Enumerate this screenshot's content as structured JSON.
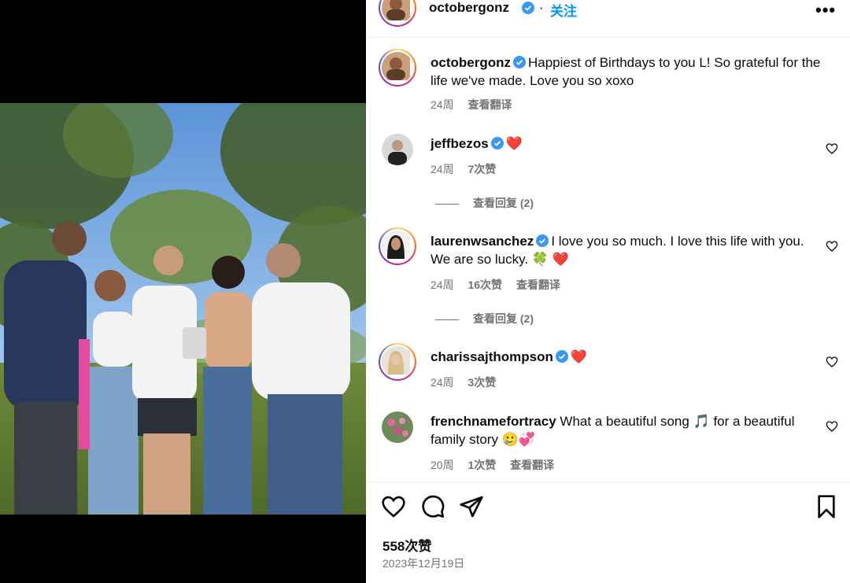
{
  "post": {
    "author": "octobergonz",
    "follow_label": "关注",
    "dot": "·",
    "more_label": "•••",
    "caption_author": "octobergonz",
    "caption_text": "Happiest of Birthdays to you L! So grateful for the life we've made. Love you so xoxo",
    "caption_time": "24周",
    "caption_translate": "查看翻译"
  },
  "comments": [
    {
      "user": "jeffbezos",
      "text": "❤️",
      "time": "24周",
      "likes": "7次赞",
      "translate": "",
      "replies": "查看回复 (2)"
    },
    {
      "user": "laurenwsanchez",
      "text": "I love you so much. I love this life with you. We are so lucky. 🍀 ❤️",
      "time": "24周",
      "likes": "16次赞",
      "translate": "查看翻译",
      "replies": "查看回复 (2)"
    },
    {
      "user": "charissajthompson",
      "text": "❤️",
      "time": "24周",
      "likes": "3次赞",
      "translate": "",
      "replies": ""
    },
    {
      "user": "frenchnamefortracy",
      "text": "What a beautiful song 🎵 for a beautiful family story 🥲💞",
      "time": "20周",
      "likes": "1次赞",
      "translate": "查看翻译",
      "replies": ""
    }
  ],
  "footer": {
    "likes": "558次赞",
    "date": "2023年12月19日"
  },
  "colors": {
    "accent": "#0095f6",
    "verified": "#3897f0",
    "muted": "#737373"
  }
}
